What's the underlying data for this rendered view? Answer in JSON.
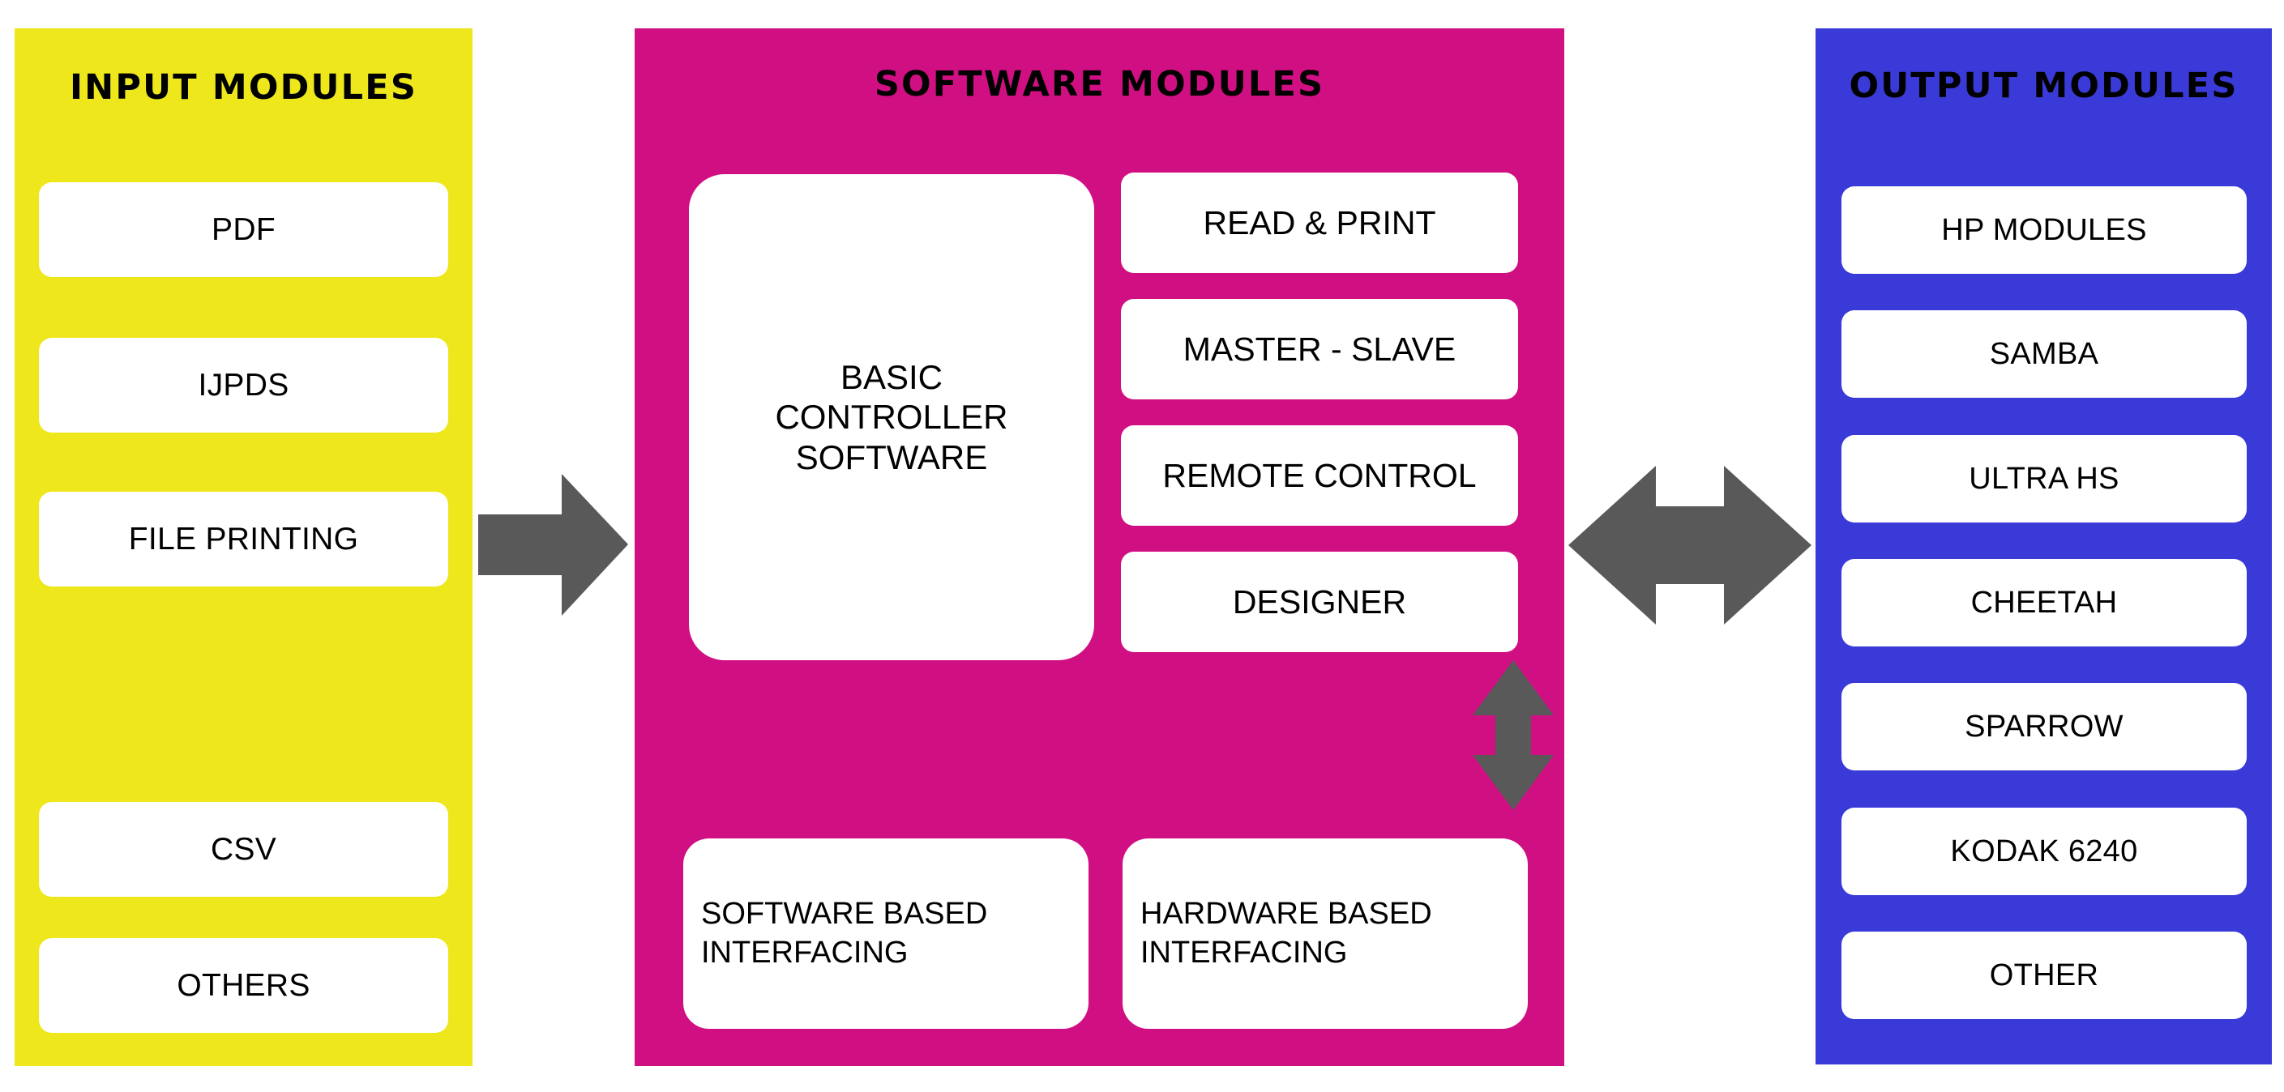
{
  "colors": {
    "input_panel": "#EDE71C",
    "software_panel": "#D00F82",
    "output_panel": "#3A3AD8",
    "arrow": "#595959",
    "card": "#FFFFFF",
    "text": "#000000"
  },
  "input_panel": {
    "title": "INPUT MODULES",
    "modules": [
      {
        "label": "PDF"
      },
      {
        "label": "IJPDS"
      },
      {
        "label": "FILE PRINTING"
      },
      {
        "label": "CSV"
      },
      {
        "label": "OTHERS"
      }
    ]
  },
  "software_panel": {
    "title": "SOFTWARE MODULES",
    "controller": {
      "line1": "BASIC",
      "line2": "CONTROLLER",
      "line3": "SOFTWARE"
    },
    "modules": [
      {
        "label": "READ & PRINT"
      },
      {
        "label": "MASTER - SLAVE"
      },
      {
        "label": "REMOTE CONTROL"
      },
      {
        "label": "DESIGNER"
      }
    ],
    "interfacing": [
      {
        "line1": "SOFTWARE BASED",
        "line2": "INTERFACING"
      },
      {
        "line1": "HARDWARE BASED",
        "line2": "INTERFACING"
      }
    ]
  },
  "output_panel": {
    "title": "OUTPUT MODULES",
    "modules": [
      {
        "label": "HP MODULES"
      },
      {
        "label": "SAMBA"
      },
      {
        "label": "ULTRA HS"
      },
      {
        "label": "CHEETAH"
      },
      {
        "label": "SPARROW"
      },
      {
        "label": "KODAK 6240"
      },
      {
        "label": "OTHER"
      }
    ]
  },
  "arrows": {
    "input_to_software": "arrow-right-icon",
    "software_to_output": "arrow-left-right-icon",
    "controller_to_software_interfacing": "arrow-up-down-icon",
    "controller_to_hardware_interfacing": "arrow-up-down-icon"
  }
}
